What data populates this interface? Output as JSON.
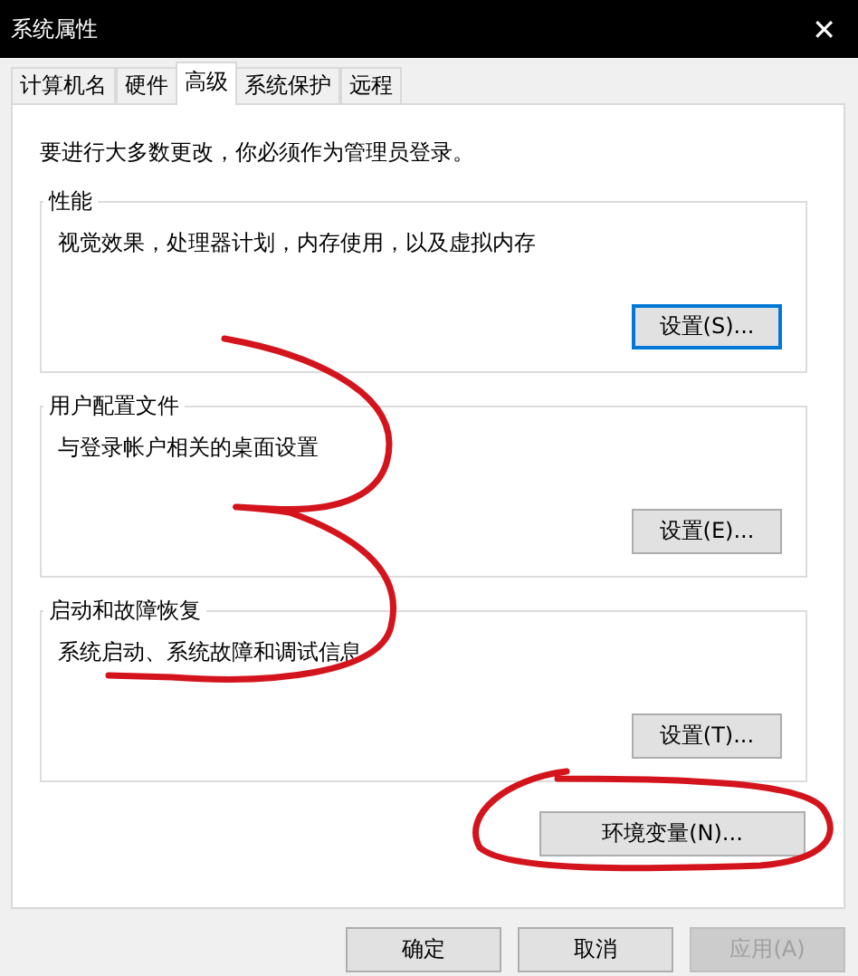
{
  "window": {
    "title": "系统属性",
    "close": "✕"
  },
  "tabs": [
    {
      "label": "计算机名",
      "selected": false
    },
    {
      "label": "硬件",
      "selected": false
    },
    {
      "label": "高级",
      "selected": true
    },
    {
      "label": "系统保护",
      "selected": false
    },
    {
      "label": "远程",
      "selected": false
    }
  ],
  "notice": "要进行大多数更改，你必须作为管理员登录。",
  "groups": [
    {
      "title": "性能",
      "description": "视觉效果，处理器计划，内存使用，以及虚拟内存",
      "button": {
        "label": "设置(S)...",
        "focused": true
      }
    },
    {
      "title": "用户配置文件",
      "description": "与登录帐户相关的桌面设置",
      "button": {
        "label": "设置(E)...",
        "focused": false
      }
    },
    {
      "title": "启动和故障恢复",
      "description": "系统启动、系统故障和调试信息",
      "button": {
        "label": "设置(T)...",
        "focused": false
      }
    }
  ],
  "env_button": "环境变量(N)...",
  "footer_buttons": [
    {
      "label": "确定",
      "disabled": false
    },
    {
      "label": "取消",
      "disabled": false
    },
    {
      "label": "应用(A)",
      "disabled": true
    }
  ]
}
